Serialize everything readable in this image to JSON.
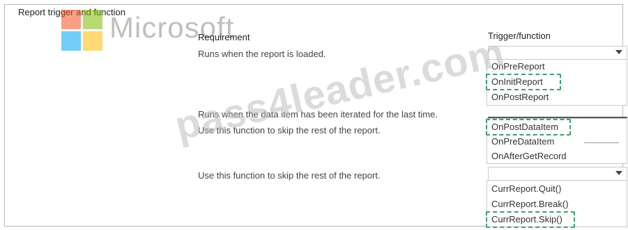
{
  "header": {
    "title": "Report trigger and function"
  },
  "watermarks": {
    "brand": "Microsoft",
    "site": "pass4leader.com"
  },
  "logo_colors": {
    "red": "#f25022",
    "green": "#7fba00",
    "blue": "#00a4ef",
    "yellow": "#ffb900"
  },
  "columns": {
    "requirement": "Requirement",
    "trigger": "Trigger/function"
  },
  "rows": [
    {
      "requirement": "Runs when the report is loaded.",
      "options": [
        "OnPreReport",
        "OnInitReport",
        "OnPostReport"
      ],
      "highlighted": "OnInitReport"
    },
    {
      "requirement": "Runs when the data item has been iterated for the last time.",
      "extra_text": "Use this function to skip the rest of the report.",
      "options": [
        "OnPostDataItem",
        "OnPreDataItem",
        "OnAfterGetRecord"
      ],
      "highlighted": "OnPostDataItem"
    },
    {
      "requirement": "Use this function to skip the rest of the report.",
      "options": [
        "CurrReport.Quit()",
        "CurrReport.Break()",
        "CurrReport.Skip()"
      ],
      "highlighted": "CurrReport.Skip()"
    }
  ],
  "highlight_color": "#3f9e6b"
}
